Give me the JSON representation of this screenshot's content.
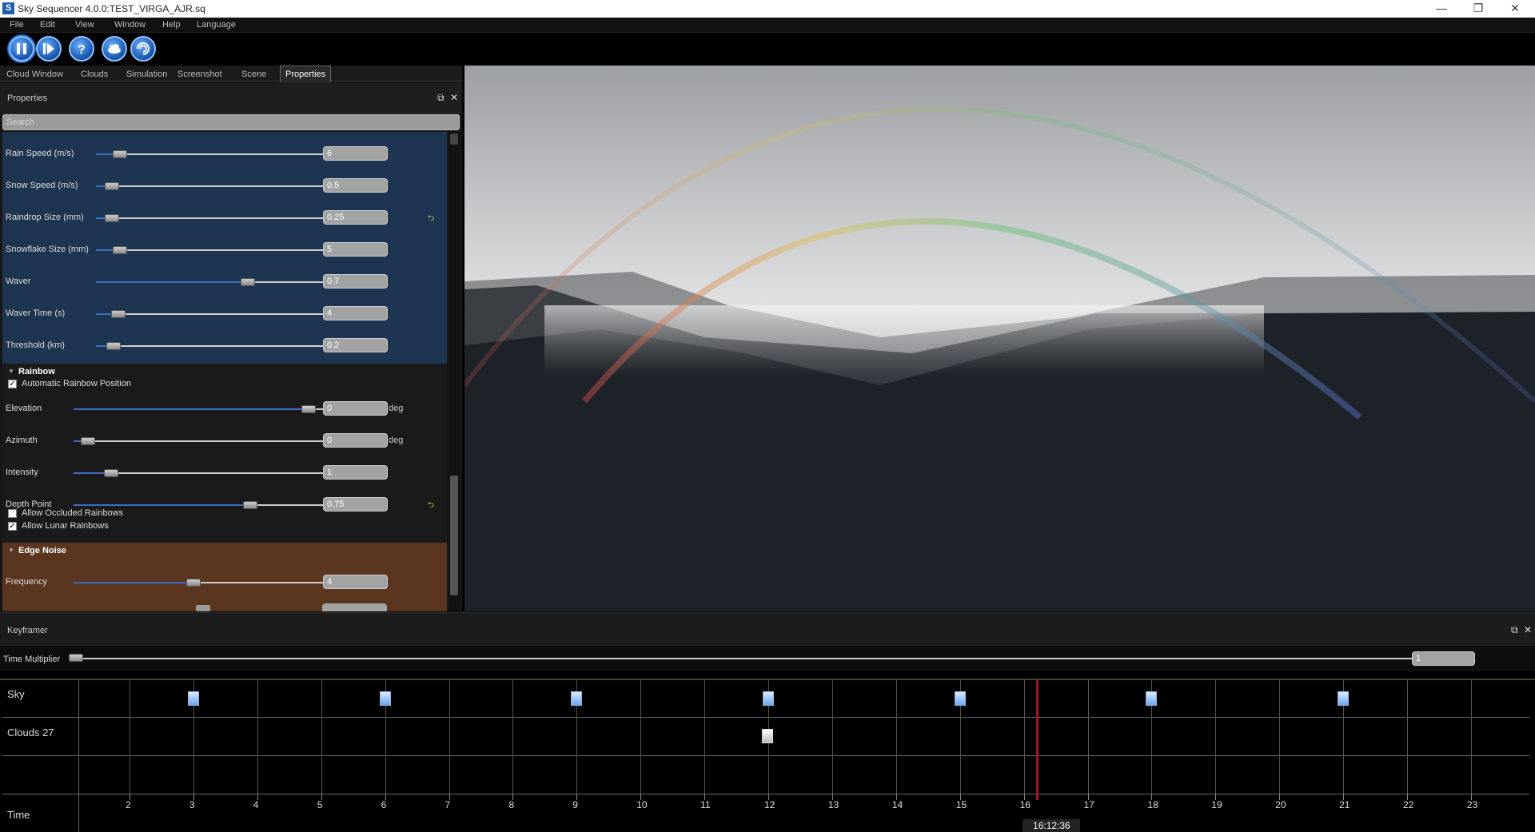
{
  "app": {
    "icon_letter": "S",
    "title": "Sky Sequencer 4.0.0:TEST_VIRGA_AJR.sq",
    "window_buttons": [
      "—",
      "❐",
      "✕"
    ]
  },
  "menu": [
    "File",
    "Edit",
    "View",
    "Window",
    "Help",
    "Language"
  ],
  "toolbar": [
    "pause",
    "play-step",
    "help",
    "cloud",
    "swirl"
  ],
  "tabs": [
    "Cloud Window",
    "Clouds",
    "Simulation",
    "Screenshot",
    "Scene",
    "Properties"
  ],
  "properties": {
    "title": "Properties",
    "search_placeholder": "Search",
    "precip_rows": [
      {
        "label": "Rain Speed (m/s)",
        "value": "6",
        "level": 0.08
      },
      {
        "label": "Snow Speed (m/s)",
        "value": "0.5",
        "level": 0.04
      },
      {
        "label": "Raindrop Size (mm)",
        "value": "0.25",
        "level": 0.04,
        "reset": true
      },
      {
        "label": "Snowflake Size (mm)",
        "value": "5",
        "level": 0.08
      },
      {
        "label": "Waver",
        "value": "0.7",
        "level": 0.68
      },
      {
        "label": "Waver Time (s)",
        "value": "4",
        "level": 0.07
      },
      {
        "label": "Threshold (km)",
        "value": "0.2",
        "level": 0.05
      }
    ],
    "rainbow": {
      "title": "Rainbow",
      "auto_position_label": "Automatic Rainbow Position",
      "auto_position_checked": true,
      "rows": [
        {
          "label": "Elevation",
          "value": "0",
          "unit": "deg",
          "level": 0.97
        },
        {
          "label": "Azimuth",
          "value": "0",
          "unit": "deg",
          "level": 0.03
        },
        {
          "label": "Intensity",
          "value": "1",
          "level": 0.13
        },
        {
          "label": "Depth Point",
          "value": "0.75",
          "level": 0.72,
          "reset": true
        }
      ],
      "occluded_label": "Allow Occluded Rainbows",
      "occluded_checked": false,
      "lunar_label": "Allow Lunar Rainbows",
      "lunar_checked": true
    },
    "edge_noise": {
      "title": "Edge Noise",
      "rows": [
        {
          "label": "Frequency",
          "value": "4",
          "level": 0.48
        }
      ]
    }
  },
  "keyframer": {
    "title": "Keyframer",
    "time_multiplier_label": "Time Multiplier",
    "time_multiplier_value": "1",
    "time_multiplier_level": 0.0,
    "tracks": [
      "Sky",
      "Clouds 27"
    ],
    "time_label": "Time",
    "hour_ticks": [
      "2",
      "3",
      "4",
      "5",
      "6",
      "7",
      "8",
      "9",
      "10",
      "11",
      "12",
      "13",
      "14",
      "15",
      "16",
      "17",
      "18",
      "19",
      "20",
      "21",
      "22",
      "23"
    ],
    "sky_keyframe_hours": [
      3,
      6,
      9,
      12,
      15,
      18,
      21
    ],
    "clouds_keyframe_hours": [
      12
    ],
    "current_time": "16:12:36",
    "current_hour": 16.21
  },
  "colors": {
    "accent": "#3a70c8",
    "precip_section": "#1d3550",
    "edge_noise_section": "#5a3620",
    "playhead": "#a01818"
  }
}
